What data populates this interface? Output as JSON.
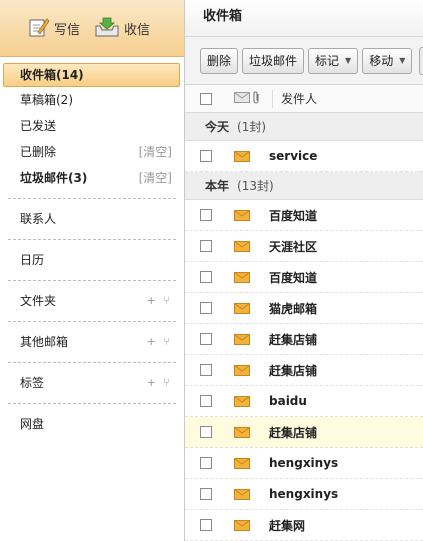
{
  "topbar": {
    "write_label": "写信",
    "receive_label": "收信"
  },
  "folders": [
    {
      "label": "收件箱(14)",
      "active": true
    },
    {
      "label": "草稿箱(2)"
    },
    {
      "label": "已发送"
    },
    {
      "label": "已删除",
      "clear": "[清空]"
    },
    {
      "label": "垃圾邮件(3)",
      "bold": true,
      "clear": "[清空]"
    }
  ],
  "sections": {
    "contacts": "联系人",
    "calendar": "日历",
    "folders": {
      "label": "文件夹",
      "add": "+ ⑂"
    },
    "other_mailbox": {
      "label": "其他邮箱",
      "add": "+ ⑂"
    },
    "tags": {
      "label": "标签",
      "add": "+ ⑂"
    },
    "netdisk": "网盘"
  },
  "main": {
    "title": "收件箱",
    "toolbar": {
      "delete": "删除",
      "spam": "垃圾邮件",
      "mark": "标记",
      "move": "移动"
    },
    "columns": {
      "sender": "发件人"
    },
    "groups": [
      {
        "name": "今天",
        "count": "(1封)",
        "rows": [
          {
            "sender": "service"
          }
        ]
      },
      {
        "name": "本年",
        "count": "(13封)",
        "rows": [
          {
            "sender": "百度知道"
          },
          {
            "sender": "天涯社区"
          },
          {
            "sender": "百度知道"
          },
          {
            "sender": "猫虎邮箱"
          },
          {
            "sender": "赶集店铺"
          },
          {
            "sender": "赶集店铺"
          },
          {
            "sender": "baidu"
          },
          {
            "sender": "赶集店铺",
            "highlight": true
          },
          {
            "sender": "hengxinys"
          },
          {
            "sender": "hengxinys"
          },
          {
            "sender": "赶集网"
          }
        ]
      }
    ]
  },
  "colors": {
    "accent": "#f6cf8f",
    "envelope": "#e8a325",
    "highlight_row": "#fffbdf"
  }
}
